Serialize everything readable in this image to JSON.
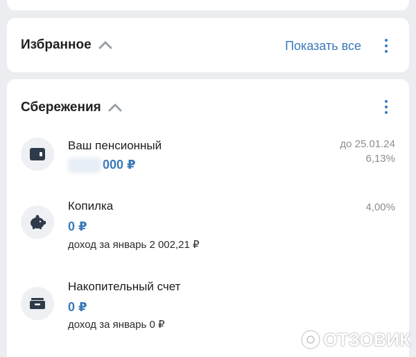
{
  "favorites": {
    "title": "Избранное",
    "show_all": "Показать все"
  },
  "savings": {
    "title": "Сбережения",
    "items": [
      {
        "title": "Ваш пенсионный",
        "amount_visible": "000 ₽",
        "right_line1": "до 25.01.24",
        "right_line2": "6,13%",
        "icon": "wallet-icon"
      },
      {
        "title": "Копилка",
        "amount": "0 ₽",
        "subtitle": "доход за январь 2 002,21 ₽",
        "right_line1": "4,00%",
        "icon": "piggy-bank-icon"
      },
      {
        "title": "Накопительный счет",
        "amount": "0 ₽",
        "subtitle": "доход за январь 0 ₽",
        "icon": "cash-box-icon"
      }
    ]
  },
  "watermark": {
    "text": "ОТЗОВИК"
  },
  "colors": {
    "accent": "#3a7ab8",
    "background": "#ebedf0",
    "card": "#ffffff",
    "icon_dark": "#2f3b4a"
  }
}
